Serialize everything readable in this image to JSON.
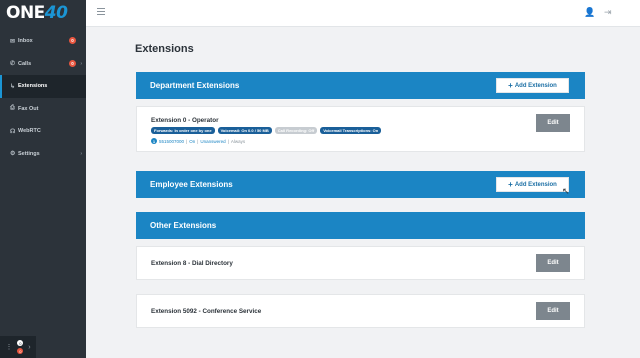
{
  "brand": {
    "logo_text": "ONE",
    "logo_number": "40"
  },
  "sidebar": {
    "items": [
      {
        "label": "Inbox",
        "icon": "envelope-icon",
        "badge": "0"
      },
      {
        "label": "Calls",
        "icon": "phone-icon",
        "badge": "0"
      },
      {
        "label": "Extensions",
        "icon": "extension-icon"
      },
      {
        "label": "Fax Out",
        "icon": "fax-icon"
      },
      {
        "label": "WebRTC",
        "icon": "headset-icon"
      },
      {
        "label": "Settings",
        "icon": "gear-icon"
      }
    ],
    "bottom_badges": [
      "0",
      "0"
    ]
  },
  "page": {
    "title": "Extensions"
  },
  "sections": {
    "department": {
      "title": "Department Extensions",
      "add_label": "Add Extension"
    },
    "employee": {
      "title": "Employee Extensions",
      "add_label": "Add Extension"
    },
    "other": {
      "title": "Other Extensions"
    }
  },
  "department_card": {
    "title": "Extension 0 - Operator",
    "tags": [
      "Forwards: In order one by one",
      "Voicemail: On 0.0 / 50 MB",
      "Call Recording: Off",
      "Voicemail Transcriptions: On"
    ],
    "detail_number": "1",
    "detail_phone": "5515007000",
    "detail_sep1": "|",
    "detail_state": "On",
    "detail_sep2": "|",
    "detail_status": "Unanswered",
    "detail_sep3": "|",
    "detail_when": "Always",
    "edit_label": "Edit"
  },
  "other_cards": [
    {
      "title": "Extension 8 - Dial Directory",
      "edit_label": "Edit"
    },
    {
      "title": "Extension 5092 - Conference Service",
      "edit_label": "Edit"
    }
  ],
  "colors": {
    "accent": "#1b85c4",
    "sidebar_bg": "#2c333a",
    "edit_bg": "#7d868e",
    "badge_red": "#e8563f"
  }
}
